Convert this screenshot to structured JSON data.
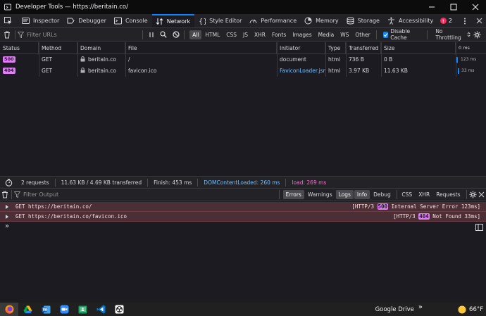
{
  "window": {
    "title": "Developer Tools — https://beritain.co/"
  },
  "tools": {
    "tabs": [
      {
        "label": "Inspector",
        "icon": "inspector-icon"
      },
      {
        "label": "Debugger",
        "icon": "debugger-icon"
      },
      {
        "label": "Console",
        "icon": "console-icon"
      },
      {
        "label": "Network",
        "icon": "network-icon",
        "selected": true
      },
      {
        "label": "Style Editor",
        "icon": "style-editor-icon"
      },
      {
        "label": "Performance",
        "icon": "performance-icon"
      },
      {
        "label": "Memory",
        "icon": "memory-icon"
      },
      {
        "label": "Storage",
        "icon": "storage-icon"
      },
      {
        "label": "Accessibility",
        "icon": "accessibility-icon"
      }
    ],
    "error_count": "2"
  },
  "network_toolbar": {
    "filter_placeholder": "Filter URLs",
    "filter_types": [
      "All",
      "HTML",
      "CSS",
      "JS",
      "XHR",
      "Fonts",
      "Images",
      "Media",
      "WS",
      "Other"
    ],
    "active_type": "All",
    "disable_cache_label": "Disable Cache",
    "throttling_label": "No Throttling"
  },
  "table": {
    "columns": [
      "Status",
      "Method",
      "Domain",
      "File",
      "Initiator",
      "Type",
      "Transferred",
      "Size",
      "0 ms"
    ],
    "rows": [
      {
        "status": "500",
        "method": "GET",
        "domain": "beritain.co",
        "file": "/",
        "initiator": "document",
        "type": "html",
        "transferred": "736 B",
        "size": "0 B",
        "timing": "123 ms"
      },
      {
        "status": "404",
        "method": "GET",
        "domain": "beritain.co",
        "file": "favicon.ico",
        "initiator": "FaviconLoader.jsm:...",
        "type": "html",
        "transferred": "3.97 KB",
        "size": "11.63 KB",
        "timing": "33 ms"
      }
    ]
  },
  "summary": {
    "requests": "2 requests",
    "transferred": "11.63 KB / 4.69 KB transferred",
    "finish": "Finish: 453 ms",
    "dcl": "DOMContentLoaded: 260 ms",
    "load": "load: 269 ms"
  },
  "console_toolbar": {
    "filter_placeholder": "Filter Output",
    "buttons": [
      {
        "label": "Errors",
        "active": true
      },
      {
        "label": "Warnings",
        "active": false
      },
      {
        "label": "Logs",
        "active": true
      },
      {
        "label": "Info",
        "active": true
      },
      {
        "label": "Debug",
        "active": false
      }
    ],
    "buttons2": [
      "CSS",
      "XHR",
      "Requests"
    ]
  },
  "console_messages": [
    {
      "text": "GET https://beritain.co/",
      "prefix": "[HTTP/3 ",
      "status": "500",
      "suffix": " Internal Server Error 123ms]"
    },
    {
      "text": "GET https://beritain.co/favicon.ico",
      "prefix": "[HTTP/3 ",
      "status": "404",
      "suffix": " Not Found 33ms]"
    }
  ],
  "console_prompt": "»",
  "taskbar": {
    "apps": [
      "firefox-icon",
      "google-drive-icon",
      "word-icon",
      "zoom-icon",
      "classroom-icon",
      "vscode-icon",
      "obs-icon"
    ],
    "drive_label": "Google Drive",
    "weather": "66°F"
  },
  "colors": {
    "accent": "#0a84ff",
    "error_bg": "#4b2f36",
    "status_badge": "#e37cf9",
    "load": "#ff6ed6",
    "dcl": "#75bfff"
  }
}
